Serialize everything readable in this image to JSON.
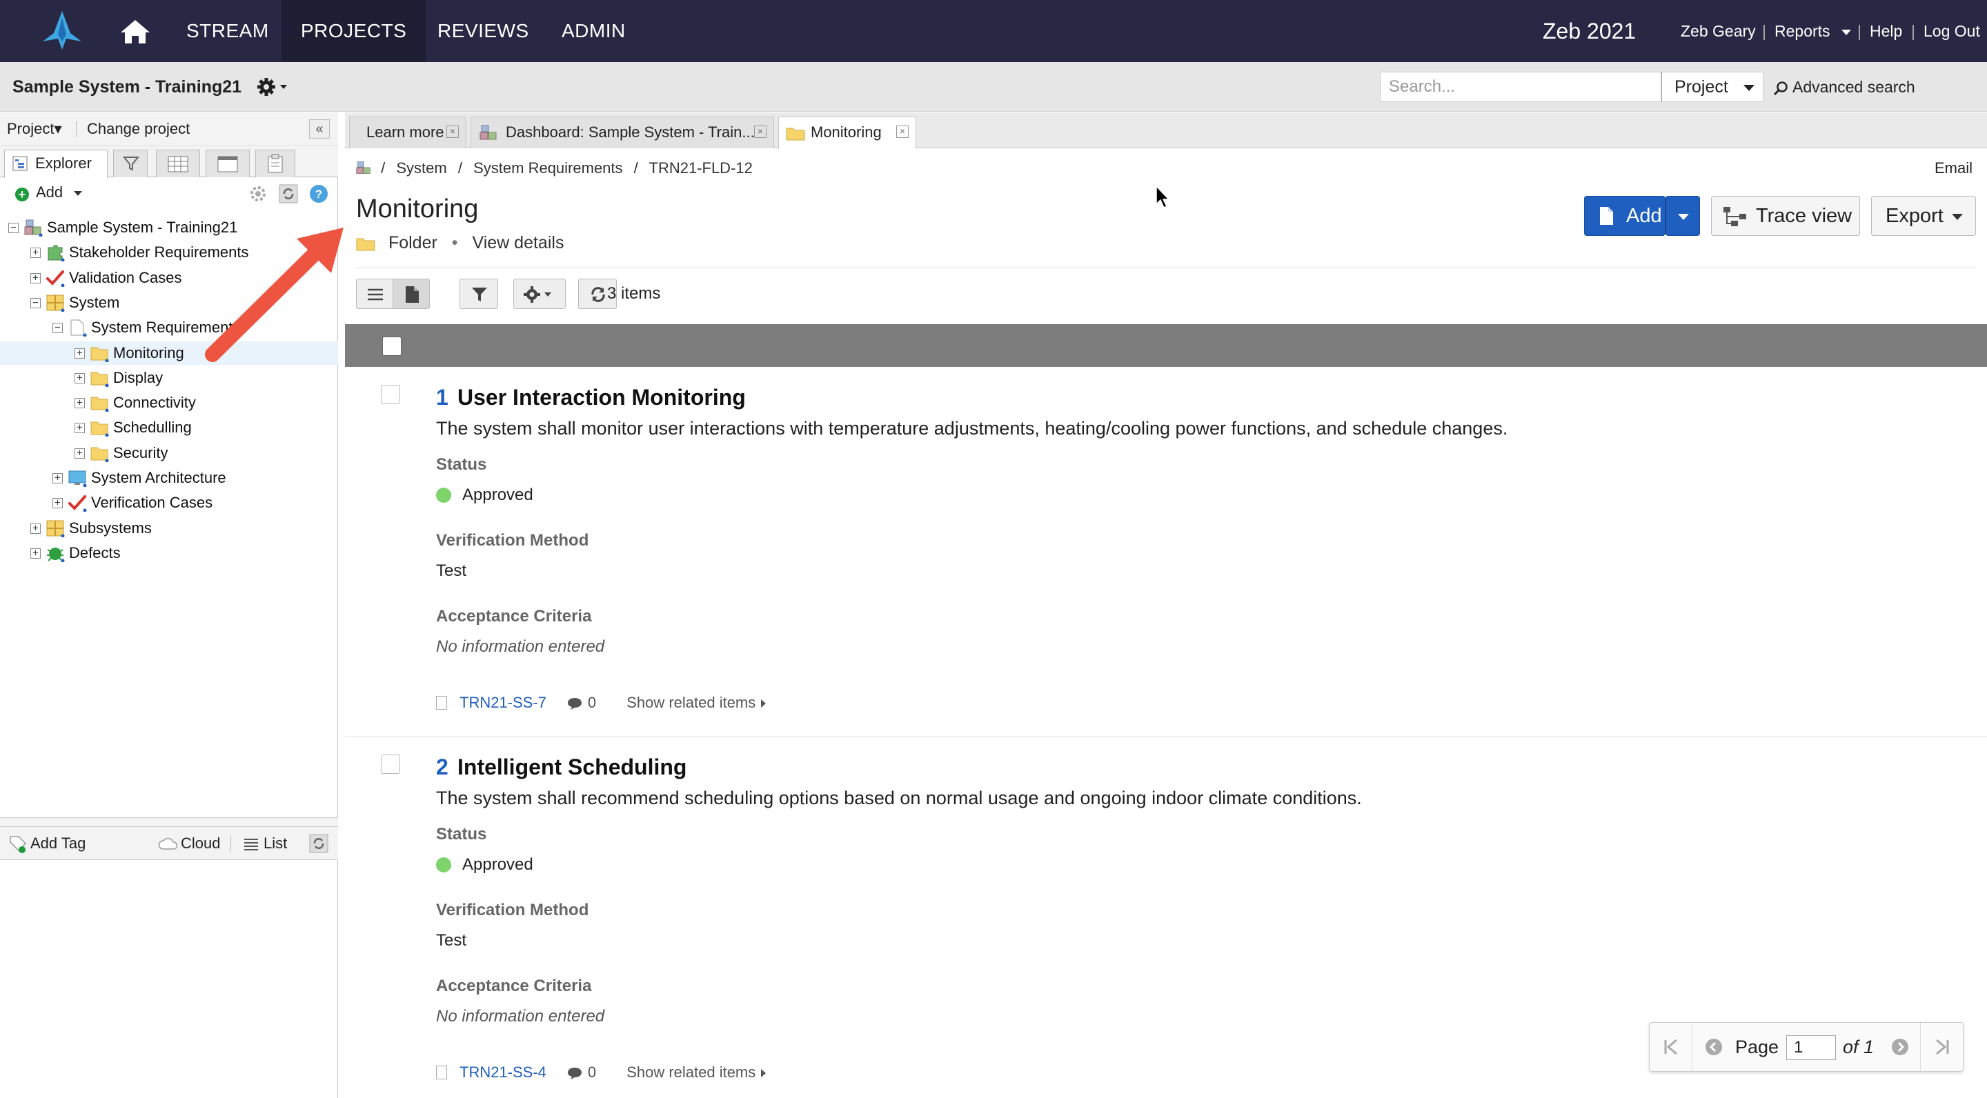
{
  "topbar": {
    "nav": [
      "STREAM",
      "PROJECTS",
      "REVIEWS",
      "ADMIN"
    ],
    "brand": "Zeb 2021",
    "user": "Zeb Geary",
    "reports": "Reports",
    "help": "Help",
    "logout": "Log Out",
    "sep": "|"
  },
  "projbar": {
    "title": "Sample System - Training21",
    "search_placeholder": "Search...",
    "scope": "Project",
    "advanced": "Advanced search"
  },
  "left": {
    "project_menu": "Project▾",
    "change_project": "Change project",
    "collapse": "«",
    "explorer_tab": "Explorer",
    "add": "Add",
    "tree": [
      {
        "label": "Sample System - Training21",
        "expander": "−"
      },
      {
        "label": "Stakeholder Requirements",
        "expander": "+"
      },
      {
        "label": "Validation Cases",
        "expander": "+"
      },
      {
        "label": "System",
        "expander": "−"
      },
      {
        "label": "System Requirements",
        "expander": "−"
      },
      {
        "label": "Monitoring",
        "expander": "+"
      },
      {
        "label": "Display",
        "expander": "+"
      },
      {
        "label": "Connectivity",
        "expander": "+"
      },
      {
        "label": "Schedulling",
        "expander": "+"
      },
      {
        "label": "Security",
        "expander": "+"
      },
      {
        "label": "System Architecture",
        "expander": "+"
      },
      {
        "label": "Verification Cases",
        "expander": "+"
      },
      {
        "label": "Subsystems",
        "expander": "+"
      },
      {
        "label": "Defects",
        "expander": "+"
      }
    ],
    "tags": {
      "add": "Add Tag",
      "cloud": "Cloud",
      "list": "List"
    }
  },
  "tabs": [
    {
      "label": "Learn more",
      "close": "×"
    },
    {
      "label": "Dashboard: Sample System - Train...",
      "close": "×"
    },
    {
      "label": "Monitoring",
      "close": "×"
    }
  ],
  "breadcrumb": [
    "/",
    "System",
    "/",
    "System Requirements",
    "/",
    "TRN21-FLD-12"
  ],
  "email": "Email",
  "page": {
    "title": "Monitoring",
    "type": "Folder",
    "bullet": "•",
    "view_details": "View details"
  },
  "actions": {
    "add": "Add",
    "trace": "Trace view",
    "export": "Export"
  },
  "items_count": "3 items",
  "items": [
    {
      "num": "1",
      "title": "User Interaction Monitoring",
      "desc": "The system shall monitor user interactions with temperature adjustments, heating/cooling power functions, and schedule changes.",
      "status_label": "Status",
      "status": "Approved",
      "vm_label": "Verification Method",
      "vm": "Test",
      "ac_label": "Acceptance Criteria",
      "ac": "No information entered",
      "related_id": "TRN21-SS-7",
      "comments": "0",
      "show_related": "Show related items"
    },
    {
      "num": "2",
      "title": "Intelligent Scheduling",
      "desc": "The system shall recommend scheduling options based on normal usage and ongoing indoor climate conditions.",
      "status_label": "Status",
      "status": "Approved",
      "vm_label": "Verification Method",
      "vm": "Test",
      "ac_label": "Acceptance Criteria",
      "ac": "No information entered",
      "related_id": "TRN21-SS-4",
      "comments": "0",
      "show_related": "Show related items"
    }
  ],
  "pager": {
    "label": "Page",
    "value": "1",
    "of": "of 1"
  },
  "colors": {
    "nav_bg": "#282845",
    "accent": "#1f5fbf",
    "approved": "#7ed36a",
    "arrow": "#ee5541"
  }
}
